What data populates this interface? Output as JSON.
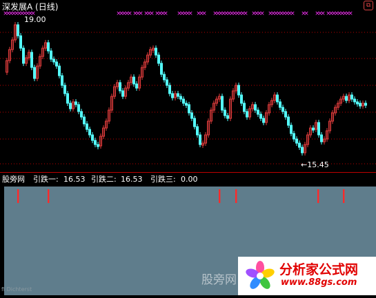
{
  "window": {
    "title": "深发展A",
    "period": "(日线)"
  },
  "main_chart": {
    "high_label": "19.00",
    "low_label": "←15.45",
    "signal_marker": "×",
    "colors": {
      "up_candle": "#e03c3c",
      "down_candle": "#54ffff",
      "signal_marker": "#ff33ff",
      "grid": "#c00000"
    }
  },
  "indicator": {
    "name": "股旁网",
    "line1_label": "引跌一:",
    "line1_value": "16.53",
    "line2_label": "引跌二:",
    "line2_value": "16.53",
    "line3_label": "引跌三:",
    "line3_value": "0.00",
    "fill_color": "#5f7d8c",
    "signal_color": "#ff2a2a"
  },
  "watermark": {
    "text": "股旁网"
  },
  "logo": {
    "title": "分析家公式网",
    "url": "www.88gs.com"
  },
  "footer": {
    "text": "fi Dichterst"
  },
  "corner_icon": "window-restore-icon"
}
